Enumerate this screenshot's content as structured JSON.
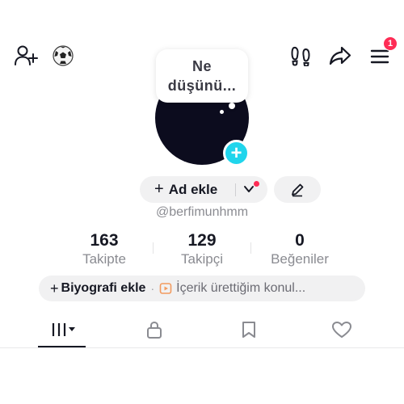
{
  "topbar": {
    "add_friend_icon": "person-plus-icon",
    "emoji": "⚽",
    "footprints_icon": "footprints-icon",
    "share_icon": "share-arrow-icon",
    "menu_icon": "hamburger-menu-icon",
    "notification_count": "1"
  },
  "profile": {
    "bubble_line1": "Ne",
    "bubble_line2": "düşünü...",
    "add_avatar_symbol": "+",
    "name_prompt": "Ad ekle",
    "username": "@berfimunhmm"
  },
  "stats": [
    {
      "value": "163",
      "label": "Takipte"
    },
    {
      "value": "129",
      "label": "Takipçi"
    },
    {
      "value": "0",
      "label": "Beğeniler"
    }
  ],
  "bio": {
    "add_label": "Biyografi ekle",
    "separator": "·",
    "creator_link": "İçerik ürettiğim konul..."
  },
  "tabs": [
    {
      "name": "videos",
      "icon": "grid-bars-icon",
      "active": true
    },
    {
      "name": "private",
      "icon": "lock-icon",
      "active": false
    },
    {
      "name": "saved",
      "icon": "bookmark-icon",
      "active": false
    },
    {
      "name": "liked",
      "icon": "heart-icon",
      "active": false
    }
  ],
  "colors": {
    "accent_red": "#fe2c55",
    "cyan": "#20d5ec",
    "avatar_bg": "#0c0c1e",
    "secondary_text": "#8a8b91"
  }
}
